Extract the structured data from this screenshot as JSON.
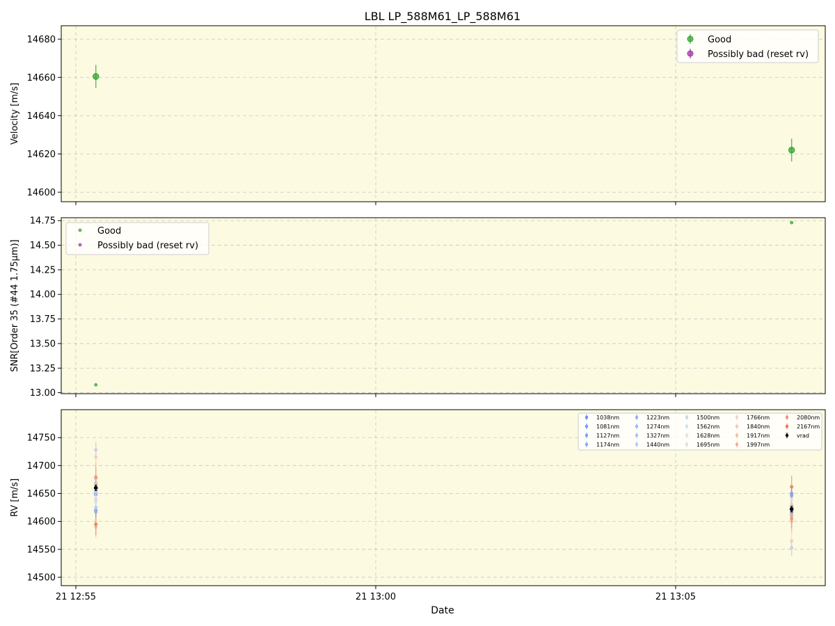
{
  "figure": {
    "title": "LBL LP_588M61_LP_588M61",
    "xlabel": "Date",
    "x_ticks": [
      "21 12:55",
      "21 13:00",
      "21 13:05"
    ]
  },
  "chart_data": [
    {
      "type": "scatter",
      "panel": "velocity",
      "ylabel": "Velocity [m/s]",
      "ylim": [
        14595,
        14687
      ],
      "y_ticks": [
        14600,
        14620,
        14640,
        14660,
        14680
      ],
      "y_tick_labels": [
        "14600",
        "14620",
        "14640",
        "14660",
        "14680"
      ],
      "grid": true,
      "legend_position": "top-right",
      "series": [
        {
          "name": "Good",
          "color": "#2ca02c",
          "points": [
            {
              "x": "12:55:20",
              "y": 14660.5,
              "err": 6
            },
            {
              "x": "13:06:56",
              "y": 14622,
              "err": 6
            }
          ]
        },
        {
          "name": "Possibly bad (reset rv)",
          "color": "#9b30a0",
          "points": []
        }
      ]
    },
    {
      "type": "scatter",
      "panel": "snr",
      "ylabel": "SNR[Order 35 (#44 1.75μm)]",
      "ylim": [
        12.99,
        14.78
      ],
      "y_ticks": [
        13.0,
        13.25,
        13.5,
        13.75,
        14.0,
        14.25,
        14.5,
        14.75
      ],
      "y_tick_labels": [
        "13.00",
        "13.25",
        "13.50",
        "13.75",
        "14.00",
        "14.25",
        "14.50",
        "14.75"
      ],
      "grid": true,
      "legend_position": "top-left",
      "series": [
        {
          "name": "Good",
          "color": "#2ca02c",
          "points": [
            {
              "x": "12:55:20",
              "y": 13.08
            },
            {
              "x": "13:06:56",
              "y": 14.73
            }
          ]
        },
        {
          "name": "Possibly bad (reset rv)",
          "color": "#9b30a0",
          "points": []
        }
      ]
    },
    {
      "type": "scatter",
      "panel": "rv",
      "ylabel": "RV [m/s]",
      "ylim": [
        14485,
        14800
      ],
      "y_ticks": [
        14500,
        14550,
        14600,
        14650,
        14700,
        14750
      ],
      "y_tick_labels": [
        "14500",
        "14550",
        "14600",
        "14650",
        "14700",
        "14750"
      ],
      "grid": true,
      "legend_position": "top-right",
      "legend_columns": 5,
      "x_positions": [
        "12:55:20",
        "13:06:56"
      ],
      "series": [
        {
          "name": "1038nm",
          "color": "#6c8cf2",
          "values": [
            14648,
            14650
          ],
          "err": [
            12,
            12
          ]
        },
        {
          "name": "1081nm",
          "color": "#7194f4",
          "values": [
            14620,
            14646
          ],
          "err": [
            12,
            12
          ]
        },
        {
          "name": "1127nm",
          "color": "#7b9cf5",
          "values": [
            14660,
            14625
          ],
          "err": [
            12,
            12
          ]
        },
        {
          "name": "1174nm",
          "color": "#86a5f6",
          "values": [
            14617,
            14618
          ],
          "err": [
            12,
            12
          ]
        },
        {
          "name": "1223nm",
          "color": "#90adf6",
          "values": [
            14652,
            14630
          ],
          "err": [
            12,
            12
          ]
        },
        {
          "name": "1274nm",
          "color": "#9bb6f6",
          "values": [
            14668,
            14615
          ],
          "err": [
            12,
            12
          ]
        },
        {
          "name": "1327nm",
          "color": "#a7bef5",
          "values": [
            14625,
            14610
          ],
          "err": [
            12,
            12
          ]
        },
        {
          "name": "1440nm",
          "color": "#b5c8f3",
          "values": [
            14728,
            14553
          ],
          "err": [
            15,
            15
          ]
        },
        {
          "name": "1500nm",
          "color": "#c6d4f0",
          "values": [
            14640,
            14620
          ],
          "err": [
            12,
            12
          ]
        },
        {
          "name": "1562nm",
          "color": "#d4dcec",
          "values": [
            14635,
            14600
          ],
          "err": [
            12,
            12
          ]
        },
        {
          "name": "1628nm",
          "color": "#e0dfe4",
          "values": [
            14665,
            14640
          ],
          "err": [
            12,
            12
          ]
        },
        {
          "name": "1695nm",
          "color": "#e8dbd5",
          "values": [
            14655,
            14625
          ],
          "err": [
            12,
            12
          ]
        },
        {
          "name": "1766nm",
          "color": "#eed5c7",
          "values": [
            14670,
            14630
          ],
          "err": [
            14,
            14
          ]
        },
        {
          "name": "1840nm",
          "color": "#f2c9b4",
          "values": [
            14715,
            14565
          ],
          "err": [
            25,
            25
          ]
        },
        {
          "name": "1917nm",
          "color": "#f4bda2",
          "values": [
            14590,
            14600
          ],
          "err": [
            20,
            20
          ]
        },
        {
          "name": "1997nm",
          "color": "#f3ad8e",
          "values": [
            14680,
            14612
          ],
          "err": [
            25,
            25
          ]
        },
        {
          "name": "2080nm",
          "color": "#ee8f74",
          "values": [
            14678,
            14605
          ],
          "err": [
            18,
            18
          ]
        },
        {
          "name": "2167nm",
          "color": "#e0755f",
          "values": [
            14595,
            14662
          ],
          "err": [
            20,
            20
          ]
        },
        {
          "name": "vrad",
          "color": "#000000",
          "values": [
            14660,
            14622
          ],
          "err": [
            5,
            5
          ]
        }
      ]
    }
  ]
}
